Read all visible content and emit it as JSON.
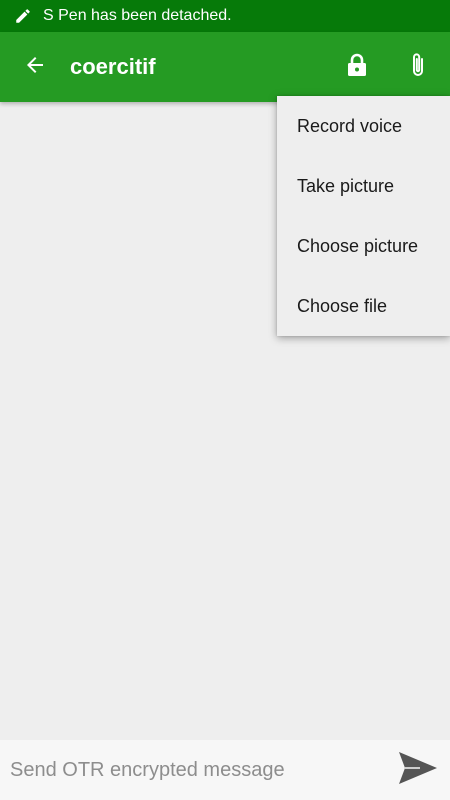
{
  "status_bar": {
    "notification_text": "S Pen has been detached.",
    "icon": "pen-icon",
    "background": "#067a09"
  },
  "app_bar": {
    "title": "coercitif",
    "back_icon": "arrow-back-icon",
    "lock_icon": "lock-icon",
    "attach_icon": "paperclip-icon",
    "background": "#259b23"
  },
  "attach_menu": {
    "items": [
      {
        "label": "Record voice"
      },
      {
        "label": "Take picture"
      },
      {
        "label": "Choose picture"
      },
      {
        "label": "Choose file"
      }
    ]
  },
  "composer": {
    "placeholder": "Send OTR encrypted message",
    "value": "",
    "send_icon": "send-icon"
  }
}
